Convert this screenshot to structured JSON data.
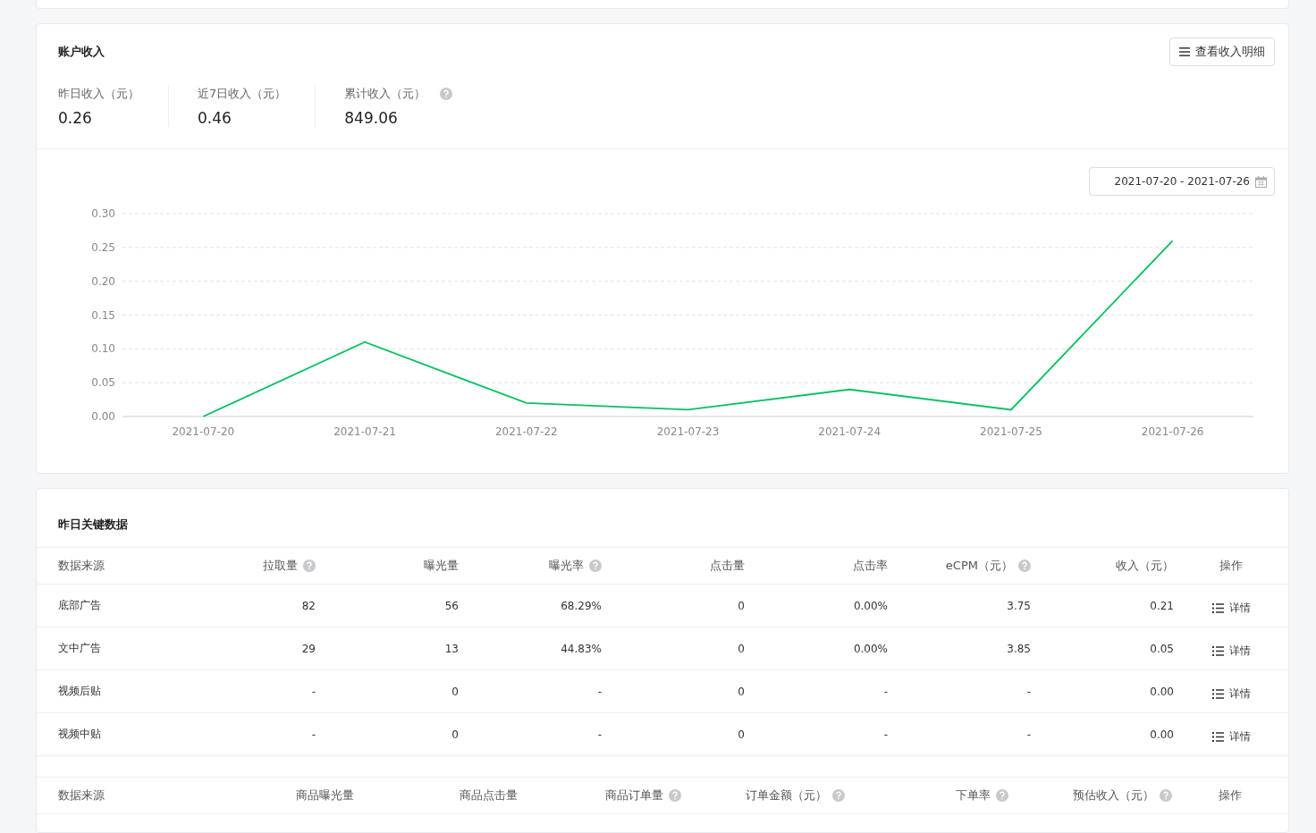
{
  "income_card": {
    "title": "账户收入",
    "detail_button": "查看收入明细",
    "stats": [
      {
        "label": "昨日收入（元）",
        "value": "0.26",
        "help": false
      },
      {
        "label": "近7日收入（元）",
        "value": "0.46",
        "help": false
      },
      {
        "label": "累计收入（元）",
        "value": "849.06",
        "help": true
      }
    ],
    "date_range": "2021-07-20 - 2021-07-26",
    "chart_data": {
      "type": "line",
      "categories": [
        "2021-07-20",
        "2021-07-21",
        "2021-07-22",
        "2021-07-23",
        "2021-07-24",
        "2021-07-25",
        "2021-07-26"
      ],
      "grid": true,
      "series": [
        {
          "color": "#07c160",
          "values": [
            0,
            0.11,
            0.02,
            0.01,
            0.04,
            0.01,
            0.26
          ]
        }
      ],
      "ylim": [
        0,
        0.3
      ],
      "yticks": [
        {
          "value": 0,
          "label": "0.00"
        },
        {
          "value": 0.05,
          "label": "0.05"
        },
        {
          "value": 0.1,
          "label": "0.10"
        },
        {
          "value": 0.15,
          "label": "0.15"
        },
        {
          "value": 0.2,
          "label": "0.20"
        },
        {
          "value": 0.25,
          "label": "0.25"
        },
        {
          "value": 0.3,
          "label": "0.30"
        }
      ]
    }
  },
  "key_data_card": {
    "title": "昨日关键数据",
    "ad_table": {
      "columns": [
        {
          "label": "数据来源",
          "help": false
        },
        {
          "label": "拉取量",
          "help": true
        },
        {
          "label": "曝光量",
          "help": false
        },
        {
          "label": "曝光率",
          "help": true
        },
        {
          "label": "点击量",
          "help": false
        },
        {
          "label": "点击率",
          "help": false
        },
        {
          "label": "eCPM（元）",
          "help": true
        },
        {
          "label": "收入（元）",
          "help": false
        },
        {
          "label": "操作",
          "help": false
        }
      ],
      "rows": [
        {
          "cells": [
            "底部广告",
            "82",
            "56",
            "68.29%",
            "0",
            "0.00%",
            "3.75",
            "0.21"
          ],
          "action": "详情"
        },
        {
          "cells": [
            "文中广告",
            "29",
            "13",
            "44.83%",
            "0",
            "0.00%",
            "3.85",
            "0.05"
          ],
          "action": "详情"
        },
        {
          "cells": [
            "视频后贴",
            "-",
            "0",
            "-",
            "0",
            "-",
            "-",
            "0.00"
          ],
          "action": "详情"
        },
        {
          "cells": [
            "视频中贴",
            "-",
            "0",
            "-",
            "0",
            "-",
            "-",
            "0.00"
          ],
          "action": "详情"
        }
      ]
    },
    "goods_table": {
      "columns": [
        {
          "label": "数据来源",
          "help": false
        },
        {
          "label": "商品曝光量",
          "help": false
        },
        {
          "label": "商品点击量",
          "help": false
        },
        {
          "label": "商品订单量",
          "help": true
        },
        {
          "label": "订单金额（元）",
          "help": true
        },
        {
          "label": "下单率",
          "help": true
        },
        {
          "label": "预估收入（元）",
          "help": true
        },
        {
          "label": "操作",
          "help": false
        }
      ]
    }
  }
}
